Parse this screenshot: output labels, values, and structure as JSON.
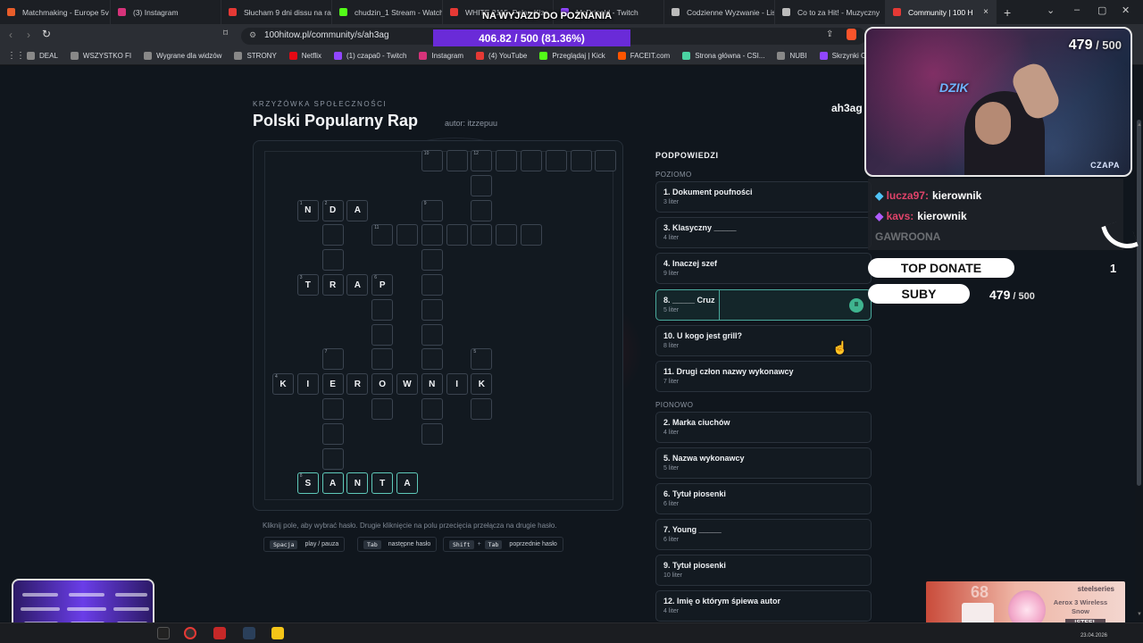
{
  "browser": {
    "tabs": [
      {
        "label": "Matchmaking - Europe 5v",
        "color": "#e85d2a"
      },
      {
        "label": "(3) Instagram",
        "color": "#d6337a"
      },
      {
        "label": "Słucham 9 dni dissu na ra",
        "color": "#e53935"
      },
      {
        "label": "chudzin_1 Stream - Watch",
        "color": "#53fc18"
      },
      {
        "label": "WHITE 2115, Pałar, Kizo",
        "color": "#e53935"
      },
      {
        "label": "McDripold - Twitch",
        "color": "#9146ff"
      },
      {
        "label": "Codzienne Wyzwanie - Lis",
        "color": "#bbbbbb"
      },
      {
        "label": "Co to za Hit! - Muzyczny",
        "color": "#bbbbbb"
      },
      {
        "label": "Community | 100 H",
        "color": "#e53935"
      }
    ],
    "close_icon": "×",
    "new_tab": "+",
    "url": "100hitow.pl/community/s/ah3ag",
    "bookmarks": [
      {
        "label": "DEAL",
        "color": "#888888"
      },
      {
        "label": "WSZYSTKO FI",
        "color": "#888888"
      },
      {
        "label": "Wygrane dla widzów",
        "color": "#888888"
      },
      {
        "label": "STRONY",
        "color": "#888888"
      },
      {
        "label": "Netflix",
        "color": "#e50914"
      },
      {
        "label": "(1) czapa0 - Twitch",
        "color": "#9146ff"
      },
      {
        "label": "Instagram",
        "color": "#d6337a"
      },
      {
        "label": "(4) YouTube",
        "color": "#e53935"
      },
      {
        "label": "Przeglądaj | Kick",
        "color": "#53fc18"
      },
      {
        "label": "FACEIT.com",
        "color": "#ff5500"
      },
      {
        "label": "Strona główna - CSI...",
        "color": "#4bd3a3"
      },
      {
        "label": "NUBI",
        "color": "#888888"
      },
      {
        "label": "Skrzynki CS:GO/CS2",
        "color": "#9146ff"
      }
    ]
  },
  "overlay": {
    "top_text": "NA WYJAZD DO POZNANIA",
    "banner": "406.82 / 500 (81.36%)",
    "cam_count": "479",
    "cam_total": " / 500",
    "cam_logo": "DZIK",
    "cam_name": "CZAPA",
    "chat": [
      {
        "user": "lucza97:",
        "msg": "kierownik"
      },
      {
        "user": "kavs:",
        "msg": "kierownik"
      },
      {
        "user": "",
        "msg": "GAWROONA"
      }
    ],
    "top_donate": "TOP DONATE",
    "top_donate_value": "1",
    "subs_label": "SUBY",
    "subs_count": "479",
    "subs_total": " / 500",
    "ad_brand": "steelseries",
    "ad_product": "Aerox 3 Wireless Snow",
    "ad_tag": "!STEEL",
    "ad_number": "68",
    "clock": "23.04.2026"
  },
  "puzzle": {
    "eyebrow": "KRZYŻÓWKA SPOŁECZNOŚCI",
    "title": "Polski Popularny Rap",
    "author": "autor: itzzepuu",
    "code": "ah3ag",
    "instructions": "Kliknij pole, aby wybrać hasło. Drugie kliknięcie na polu przecięcia przełącza na drugie hasło.",
    "shortcuts": [
      {
        "keys": [
          "Spacja"
        ],
        "label": "play / pauza"
      },
      {
        "keys": [
          "Tab"
        ],
        "label": "następne hasło"
      },
      {
        "keys": [
          "Shift",
          "Tab"
        ],
        "label": "poprzednie hasło"
      }
    ],
    "plus": "+"
  },
  "clues": {
    "title": "PODPOWIEDZI",
    "across_label": "POZIOMO",
    "down_label": "PIONOWO",
    "across": [
      {
        "q": "1. Dokument poufności",
        "n": "3 liter"
      },
      {
        "q": "3. Klasyczny _____",
        "n": "4 liter"
      },
      {
        "q": "4. Inaczej szef",
        "n": "9 liter"
      },
      {
        "q": "8. _____ Cruz",
        "n": "5 liter"
      },
      {
        "q": "10. U kogo jest grill?",
        "n": "8 liter"
      },
      {
        "q": "11. Drugi człon nazwy wykonawcy",
        "n": "7 liter"
      }
    ],
    "down": [
      {
        "q": "2. Marka ciuchów",
        "n": "4 liter"
      },
      {
        "q": "5. Nazwa wykonawcy",
        "n": "5 liter"
      },
      {
        "q": "6. Tytuł piosenki",
        "n": "6 liter"
      },
      {
        "q": "7. Young _____",
        "n": "6 liter"
      },
      {
        "q": "9. Tytuł piosenki",
        "n": "10 liter"
      },
      {
        "q": "12. Imię o którym śpiewa autor",
        "n": "4 liter"
      }
    ],
    "pause_icon": "II"
  },
  "grid": {
    "numbers": {
      "r0c6": "10",
      "r0c8": "12",
      "r2c1": "1",
      "r2c2": "2",
      "r2c6": "9",
      "r3c4": "11",
      "r5c1": "3",
      "r5c4": "6",
      "r8c2": "7",
      "r8c8": "5",
      "r9c0": "4",
      "r13c1": "8"
    },
    "letters": {
      "r2c1": "N",
      "r2c2": "D",
      "r2c3": "A",
      "r5c1": "T",
      "r5c2": "R",
      "r5c3": "A",
      "r5c4": "P",
      "r9c0": "K",
      "r9c1": "I",
      "r9c2": "E",
      "r9c3": "R",
      "r9c4": "O",
      "r9c5": "W",
      "r9c6": "N",
      "r9c7": "I",
      "r9c8": "K",
      "r13c1": "S",
      "r13c2": "A",
      "r13c3": "N",
      "r13c4": "T",
      "r13c5": "A"
    }
  }
}
